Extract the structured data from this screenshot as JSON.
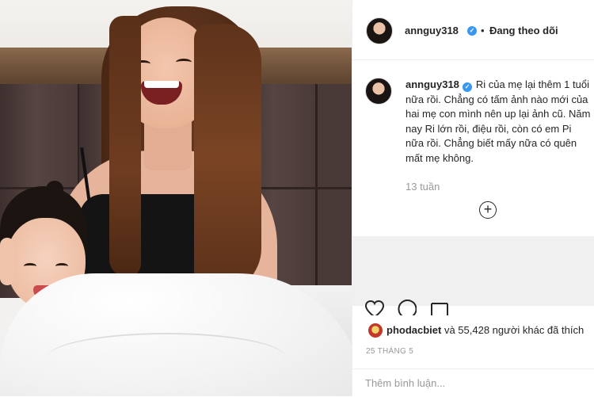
{
  "post": {
    "username": "annguy318",
    "follow_label": "Đang theo dõi",
    "separator": "•"
  },
  "caption": {
    "username": "annguy318",
    "text": "Ri của mẹ lại thêm 1 tuổi nữa rồi. Chẳng có tấm ảnh nào mới của hai mẹ con mình nên up lại ảnh cũ. Năm nay Ri lớn rồi, điệu rồi, còn có em Pi nữa rồi. Chẳng biết mấy nữa có quên mất mẹ không.",
    "time": "13 tuần",
    "more_icon": "plus-circle-icon"
  },
  "likes": {
    "user": "phodacbiet",
    "text": " và 55,428 người khác đã thích"
  },
  "date": "25 THÁNG 5",
  "comment": {
    "placeholder": "Thêm bình luận..."
  },
  "icons": {
    "verified": "verified-badge-icon",
    "like": "heart-icon",
    "comment": "comment-icon",
    "share": "share-icon"
  },
  "colors": {
    "verified": "#3897f0",
    "muted": "#999999",
    "text": "#262626",
    "border": "#efefef"
  }
}
